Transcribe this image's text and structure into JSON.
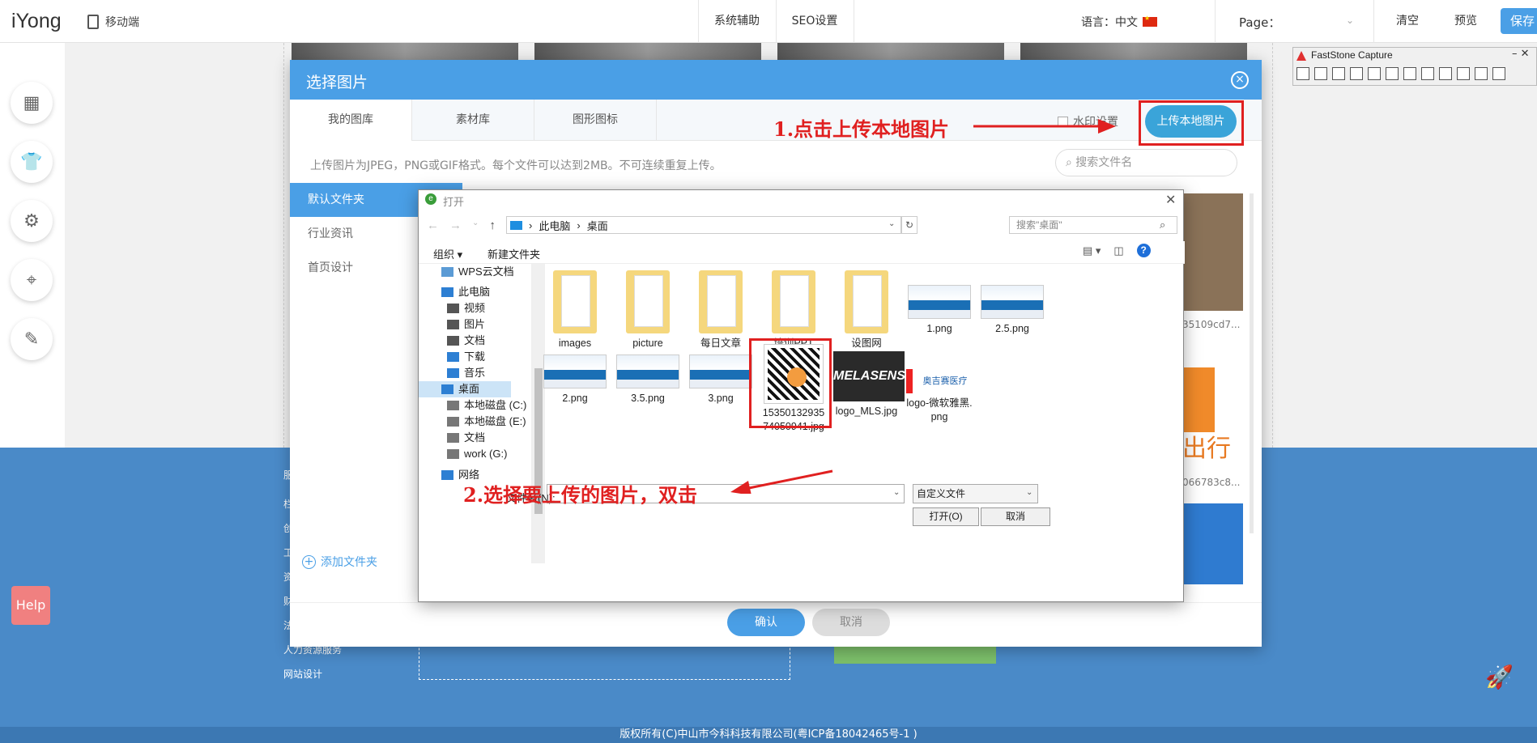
{
  "topbar": {
    "logo": "iYong",
    "mobile": "移动端",
    "menu": [
      "系统辅助",
      "SEO设置"
    ],
    "language": "语言：中文",
    "page_label": "Page：",
    "actions": [
      "清空",
      "预览"
    ],
    "save": "保存"
  },
  "modal": {
    "title": "选择图片",
    "tabs": [
      "我的图库",
      "素材库",
      "图形图标"
    ],
    "watermark": "水印设置",
    "upload_button": "上传本地图片",
    "hint": "上传图片为JPEG，PNG或GIF格式。每个文件可以达到2MB。不可连续重复上传。",
    "search_placeholder": "搜索文件名",
    "folders": [
      "默认文件夹",
      "行业资讯",
      "首页设计"
    ],
    "add_folder": "添加文件夹",
    "ok": "确认",
    "cancel": "取消",
    "right_captions": [
      "35109cd7...",
      "066783c8..."
    ],
    "right_text": "出行"
  },
  "dialog": {
    "title": "打开",
    "path": [
      "此电脑",
      "桌面"
    ],
    "search_placeholder": "搜索\"桌面\"",
    "toolbar": {
      "organize": "组织",
      "new_folder": "新建文件夹"
    },
    "nav": [
      {
        "label": "WPS云文档",
        "icon": "cloud-icon",
        "level": 0
      },
      {
        "label": "此电脑",
        "icon": "computer-icon",
        "level": 0
      },
      {
        "label": "视频",
        "icon": "video-icon",
        "level": 1
      },
      {
        "label": "图片",
        "icon": "pictures-icon",
        "level": 1
      },
      {
        "label": "文档",
        "icon": "document-icon",
        "level": 1
      },
      {
        "label": "下载",
        "icon": "download-icon",
        "level": 1
      },
      {
        "label": "音乐",
        "icon": "music-icon",
        "level": 1
      },
      {
        "label": "桌面",
        "icon": "desktop-icon",
        "level": 1
      },
      {
        "label": "本地磁盘 (C:)",
        "icon": "drive-icon",
        "level": 1
      },
      {
        "label": "本地磁盘 (E:)",
        "icon": "drive-icon",
        "level": 1
      },
      {
        "label": "文档",
        "icon": "drive-icon",
        "level": 1
      },
      {
        "label": "work (G:)",
        "icon": "drive-icon",
        "level": 1
      },
      {
        "label": "网络",
        "icon": "network-icon",
        "level": 0
      }
    ],
    "files": [
      {
        "name": "images",
        "type": "folder"
      },
      {
        "name": "picture",
        "type": "folder"
      },
      {
        "name": "每日文章",
        "type": "folder"
      },
      {
        "name": "培训PPT",
        "type": "folder"
      },
      {
        "name": "设图网",
        "type": "folder"
      },
      {
        "name": "1.png",
        "type": "png"
      },
      {
        "name": "2.5.png",
        "type": "png"
      },
      {
        "name": "2.png",
        "type": "png"
      },
      {
        "name": "3.5.png",
        "type": "png"
      },
      {
        "name": "3.png",
        "type": "png"
      },
      {
        "name": "1535013293574050941.jpg",
        "type": "qr"
      },
      {
        "name": "logo_MLS.jpg",
        "type": "mls"
      },
      {
        "name": "logo-微软雅黑.png",
        "type": "augs"
      }
    ],
    "mls_text": "MELASENS",
    "augs_text": "奥吉赛医疗",
    "filename_label": "文件名(N):",
    "filetype": "自定义文件",
    "open": "打开(O)",
    "cancel": "取消"
  },
  "annotations": {
    "step1": "1.点击上传本地图片",
    "step2": "2.选择要上传的图片，双击"
  },
  "faststone": {
    "title": "FastStone Capture"
  },
  "footer": {
    "links": [
      "服",
      "栏",
      "创",
      "工",
      "资",
      "财",
      "法",
      "人力资源服务",
      "网站设计"
    ],
    "copyright": "版权所有(C)中山市今科科技有限公司(粤ICP备18042465号-1 )"
  },
  "help": "Help",
  "colors": {
    "primary": "#4a9fe6",
    "annotation": "#e02020",
    "footer": "#4a8ac8"
  }
}
